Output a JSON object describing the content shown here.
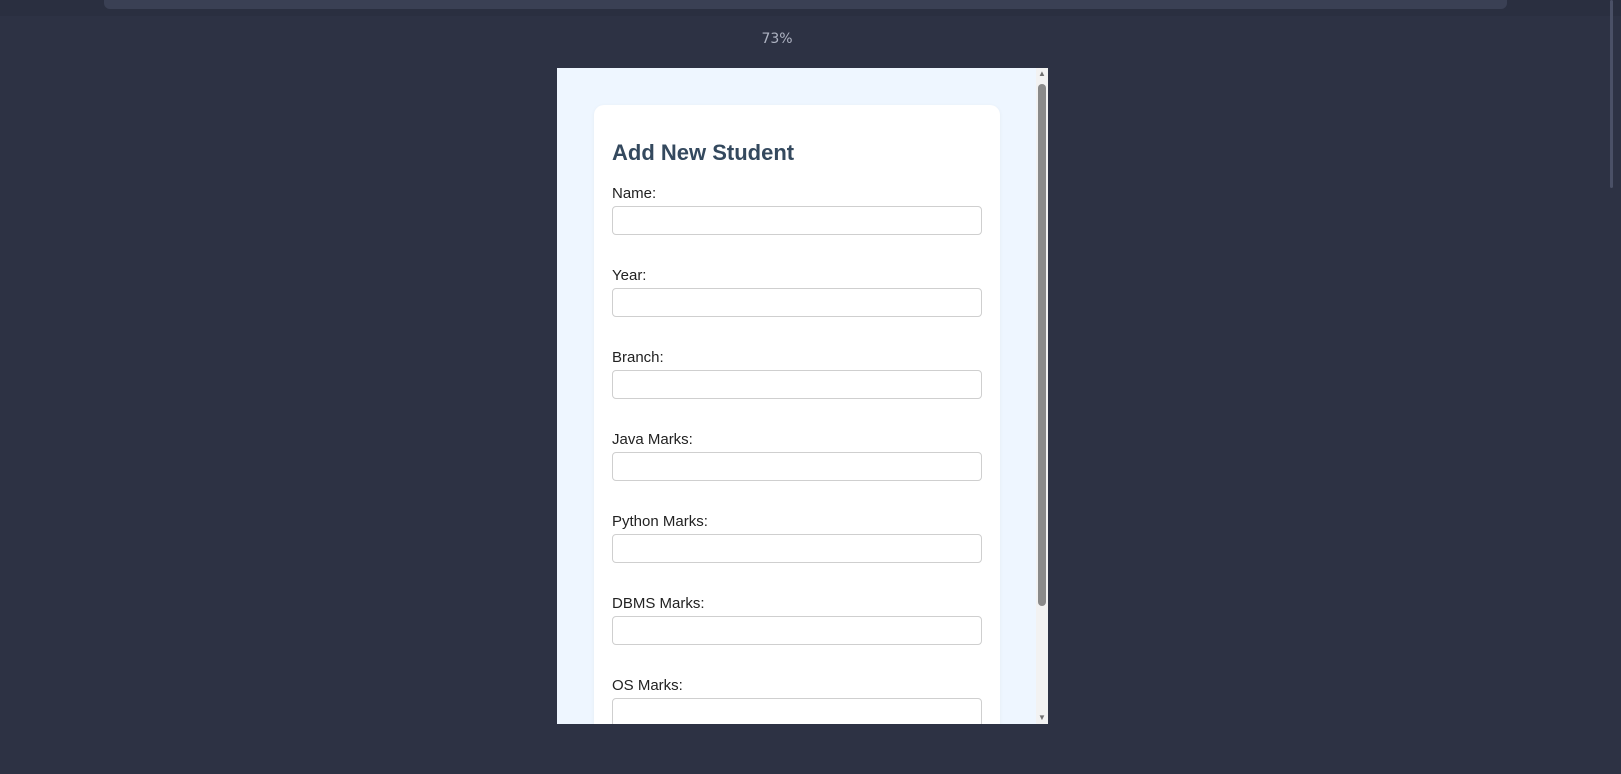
{
  "zoom_level": "73%",
  "form": {
    "title": "Add New Student",
    "fields": [
      {
        "label": "Name:",
        "value": ""
      },
      {
        "label": "Year:",
        "value": ""
      },
      {
        "label": "Branch:",
        "value": ""
      },
      {
        "label": "Java Marks:",
        "value": ""
      },
      {
        "label": "Python Marks:",
        "value": ""
      },
      {
        "label": "DBMS Marks:",
        "value": ""
      },
      {
        "label": "OS Marks:",
        "value": ""
      }
    ]
  },
  "colors": {
    "app_background": "#2d3244",
    "page_background": "#eef6ff",
    "card_background": "#ffffff",
    "title_color": "#34495e"
  }
}
